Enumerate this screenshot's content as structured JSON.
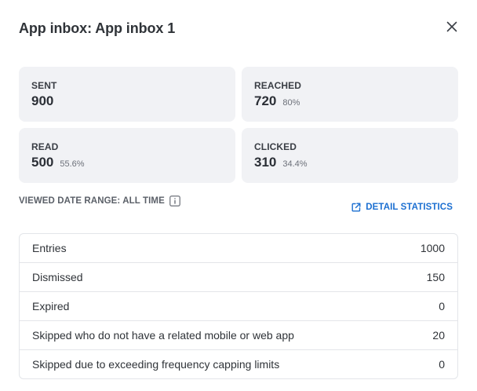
{
  "dialog": {
    "title": "App inbox: App inbox 1",
    "close_icon": "close-icon"
  },
  "stats": [
    {
      "label": "SENT",
      "value": "900",
      "percent": ""
    },
    {
      "label": "REACHED",
      "value": "720",
      "percent": "80%"
    },
    {
      "label": "READ",
      "value": "500",
      "percent": "55.6%"
    },
    {
      "label": "CLICKED",
      "value": "310",
      "percent": "34.4%"
    }
  ],
  "date_range": {
    "label": "VIEWED DATE RANGE: ALL TIME",
    "info_icon": "info-icon"
  },
  "detail_link": {
    "label": "DETAIL STATISTICS",
    "icon": "external-link-icon"
  },
  "table": {
    "rows": [
      {
        "label": "Entries",
        "value": "1000"
      },
      {
        "label": "Dismissed",
        "value": "150"
      },
      {
        "label": "Expired",
        "value": "0"
      },
      {
        "label": "Skipped who do not have a related mobile or web app",
        "value": "20"
      },
      {
        "label": "Skipped due to exceeding frequency capping limits",
        "value": "0"
      }
    ]
  },
  "colors": {
    "accent": "#1b6fd1",
    "card_bg": "#f1f2f5",
    "border": "#e3e5e9"
  }
}
